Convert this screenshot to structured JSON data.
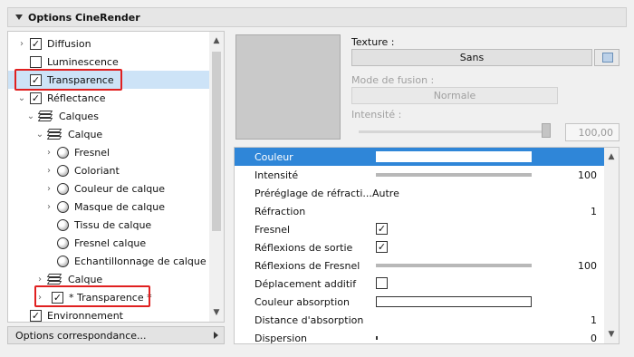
{
  "panel": {
    "title": "Options CineRender"
  },
  "tree": {
    "items": [
      {
        "label": "Diffusion"
      },
      {
        "label": "Luminescence"
      },
      {
        "label": "Transparence"
      },
      {
        "label": "Réflectance"
      },
      {
        "label": "Calques"
      },
      {
        "label": "Calque"
      },
      {
        "label": "Fresnel"
      },
      {
        "label": "Coloriant"
      },
      {
        "label": "Couleur de calque"
      },
      {
        "label": "Masque de calque"
      },
      {
        "label": "Tissu de calque"
      },
      {
        "label": "Fresnel calque"
      },
      {
        "label": "Echantillonnage de calque"
      },
      {
        "label": "Calque"
      },
      {
        "label": "* Transparence *"
      },
      {
        "label": "Environnement"
      }
    ],
    "bottom_button": "Options correspondance..."
  },
  "texture": {
    "label": "Texture :",
    "value": "Sans",
    "blend_label": "Mode de fusion :",
    "blend_value": "Normale",
    "intensity_label": "Intensité :",
    "intensity_value": "100,00"
  },
  "props": [
    {
      "name": "Couleur"
    },
    {
      "name": "Intensité",
      "value": "100"
    },
    {
      "name": "Préréglage de réfracti...",
      "value": "Autre"
    },
    {
      "name": "Réfraction",
      "value": "1"
    },
    {
      "name": "Fresnel"
    },
    {
      "name": "Réflexions de sortie"
    },
    {
      "name": "Réflexions de Fresnel",
      "value": "100"
    },
    {
      "name": "Déplacement additif"
    },
    {
      "name": "Couleur absorption"
    },
    {
      "name": "Distance d'absorption",
      "value": "1"
    },
    {
      "name": "Dispersion",
      "value": "0"
    }
  ],
  "colors": {
    "selection": "#2f86d8",
    "highlight_box": "#e02020"
  }
}
